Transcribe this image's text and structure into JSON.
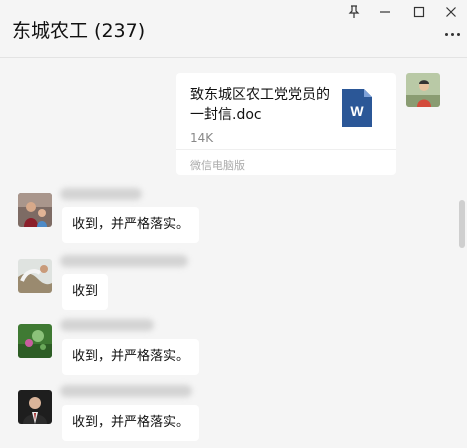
{
  "window": {
    "title": "东城农工 (237)",
    "controls": {
      "pin": "pin-icon",
      "minimize": "minimize-icon",
      "maximize": "maximize-icon",
      "close": "close-icon"
    },
    "more": "more-icon"
  },
  "file_message": {
    "filename": "致东城区农工党党员的一封信.doc",
    "size": "14K",
    "source": "微信电脑版",
    "icon": "word-document-icon",
    "icon_letter": "W",
    "icon_color": "#2b5797"
  },
  "messages": [
    {
      "text": "收到，并严格落实。"
    },
    {
      "text": "收到"
    },
    {
      "text": "收到，并严格落实。"
    },
    {
      "text": "收到，并严格落实。"
    }
  ],
  "colors": {
    "background": "#f5f5f5",
    "bubble": "#ffffff",
    "accent_blue": "#2b5797"
  }
}
